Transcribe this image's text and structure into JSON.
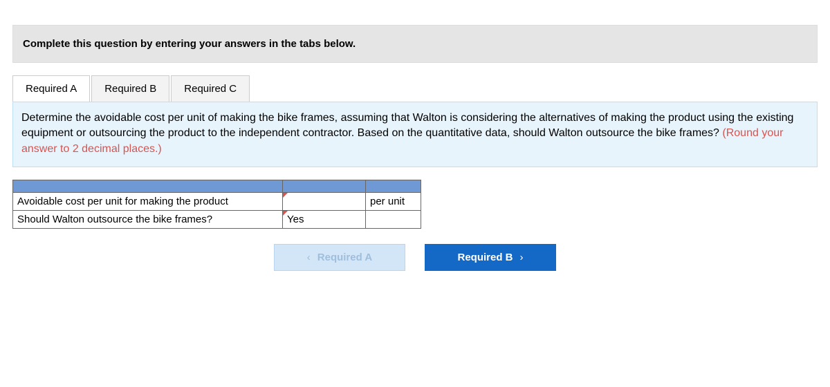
{
  "instruction": "Complete this question by entering your answers in the tabs below.",
  "tabs": {
    "a": "Required A",
    "b": "Required B",
    "c": "Required C"
  },
  "question": {
    "body": "Determine the avoidable cost per unit of making the bike frames, assuming that Walton is considering the alternatives of making the product using the existing equipment or outsourcing the product to the independent contractor. Based on the quantitative data, should Walton outsource the bike frames? ",
    "note": "(Round your answer to 2 decimal places.)"
  },
  "table": {
    "row1_label": "Avoidable cost per unit for making the product",
    "row1_value": "",
    "row1_unit": "per unit",
    "row2_label": "Should Walton outsource the bike frames?",
    "row2_value": "Yes"
  },
  "nav": {
    "prev": "Required A",
    "next": "Required B"
  }
}
